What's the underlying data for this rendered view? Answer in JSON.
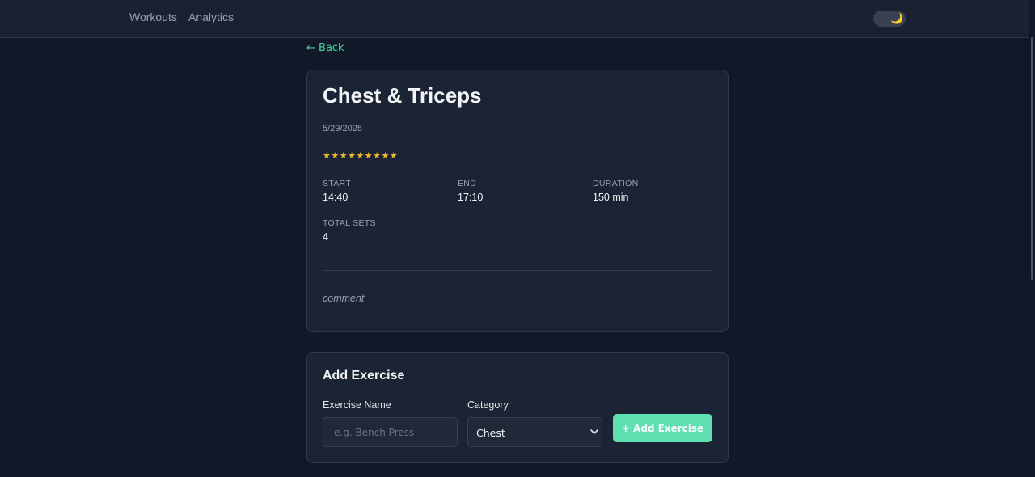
{
  "nav": {
    "workouts": "Workouts",
    "analytics": "Analytics",
    "theme_icon": "moon-icon"
  },
  "back_label": "← Back",
  "workout": {
    "title": "Chest & Triceps",
    "date": "5/29/2025",
    "rating": "★★★★★★★★★",
    "rating_value": 9,
    "stats": {
      "start_label": "START",
      "start_value": "14:40",
      "end_label": "END",
      "end_value": "17:10",
      "duration_label": "DURATION",
      "duration_value": "150 min",
      "total_sets_label": "TOTAL SETS",
      "total_sets_value": "4"
    },
    "comment": "comment"
  },
  "add_exercise": {
    "title": "Add Exercise",
    "name_label": "Exercise Name",
    "name_placeholder": "e.g. Bench Press",
    "name_value": "",
    "category_label": "Category",
    "category_selected": "Chest",
    "button_label": "+ Add Exercise"
  },
  "colors": {
    "accent": "#5fe0b0",
    "link": "#4fd1a5",
    "star": "#f5b82e",
    "background": "#111827",
    "card": "#1b2434"
  }
}
